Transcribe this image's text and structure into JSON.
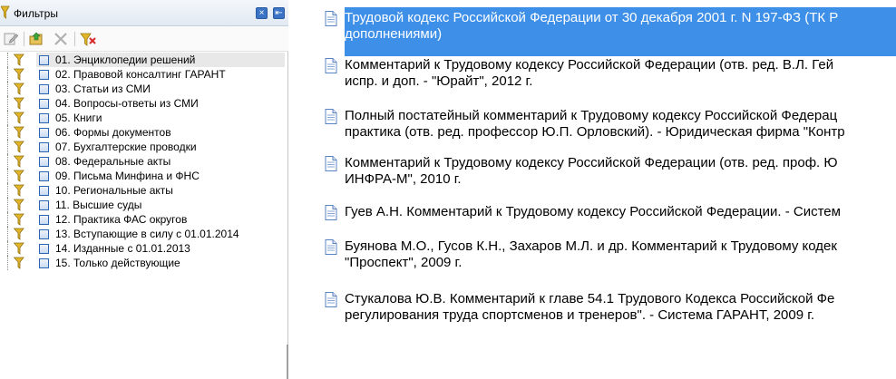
{
  "panel": {
    "title": "Фильтры",
    "close_glyph": "×",
    "pin_glyph": "⇤"
  },
  "toolbar_icons": [
    "edit-filter-icon",
    "open-folder-icon",
    "delete-icon",
    "reset-filter-icon"
  ],
  "filters": [
    {
      "label": "01. Энциклопедии решений",
      "selected": true
    },
    {
      "label": "02. Правовой консалтинг ГАРАНТ"
    },
    {
      "label": "03. Статьи из СМИ"
    },
    {
      "label": "04. Вопросы-ответы из СМИ"
    },
    {
      "label": "05. Книги"
    },
    {
      "label": "06. Формы документов"
    },
    {
      "label": "07. Бухгалтерские проводки"
    },
    {
      "label": "08. Федеральные акты"
    },
    {
      "label": "09. Письма Минфина и ФНС"
    },
    {
      "label": "10. Региональные акты"
    },
    {
      "label": "11. Высшие суды"
    },
    {
      "label": "12. Практика ФАС округов"
    },
    {
      "label": "13. Вступающие в силу с 01.01.2014"
    },
    {
      "label": "14. Изданные с 01.01.2013"
    },
    {
      "label": "15. Только действующие"
    }
  ],
  "documents": [
    {
      "line1": "Трудовой кодекс Российской Федерации от 30 декабря 2001 г. N 197-ФЗ (ТК Р",
      "line2": "дополнениями)",
      "selected": true
    },
    {
      "line1": "Комментарий к Трудовому кодексу Российской Федерации (отв. ред. В.Л. Гей",
      "line2": "испр. и доп. - \"Юрайт\", 2012 г."
    },
    {
      "line1": "Полный постатейный комментарий к Трудовому кодексу Российской Федерац",
      "line2": "практика (отв. ред. профессор Ю.П. Орловский). - Юридическая фирма \"Контр"
    },
    {
      "line1": "Комментарий к Трудовому кодексу Российской Федерации (отв. ред. проф. Ю",
      "line2": "ИНФРА-М\", 2010 г."
    },
    {
      "line1": "Гуев А.Н. Комментарий к Трудовому кодексу Российской Федерации. - Систем",
      "line2": ""
    },
    {
      "line1": "Буянова М.О., Гусов К.Н., Захаров М.Л. и др. Комментарий к Трудовому кодек",
      "line2": "\"Проспект\", 2009 г."
    },
    {
      "line1": "Стукалова Ю.В. Комментарий к главе 54.1 Трудового Кодекса Российской Фе",
      "line2": "регулирования труда спортсменов и тренеров\". - Система ГАРАНТ, 2009 г."
    }
  ],
  "colors": {
    "selection": "#3d8fe8",
    "header_button": "#3b74c4",
    "funnel": "#d9b020"
  }
}
